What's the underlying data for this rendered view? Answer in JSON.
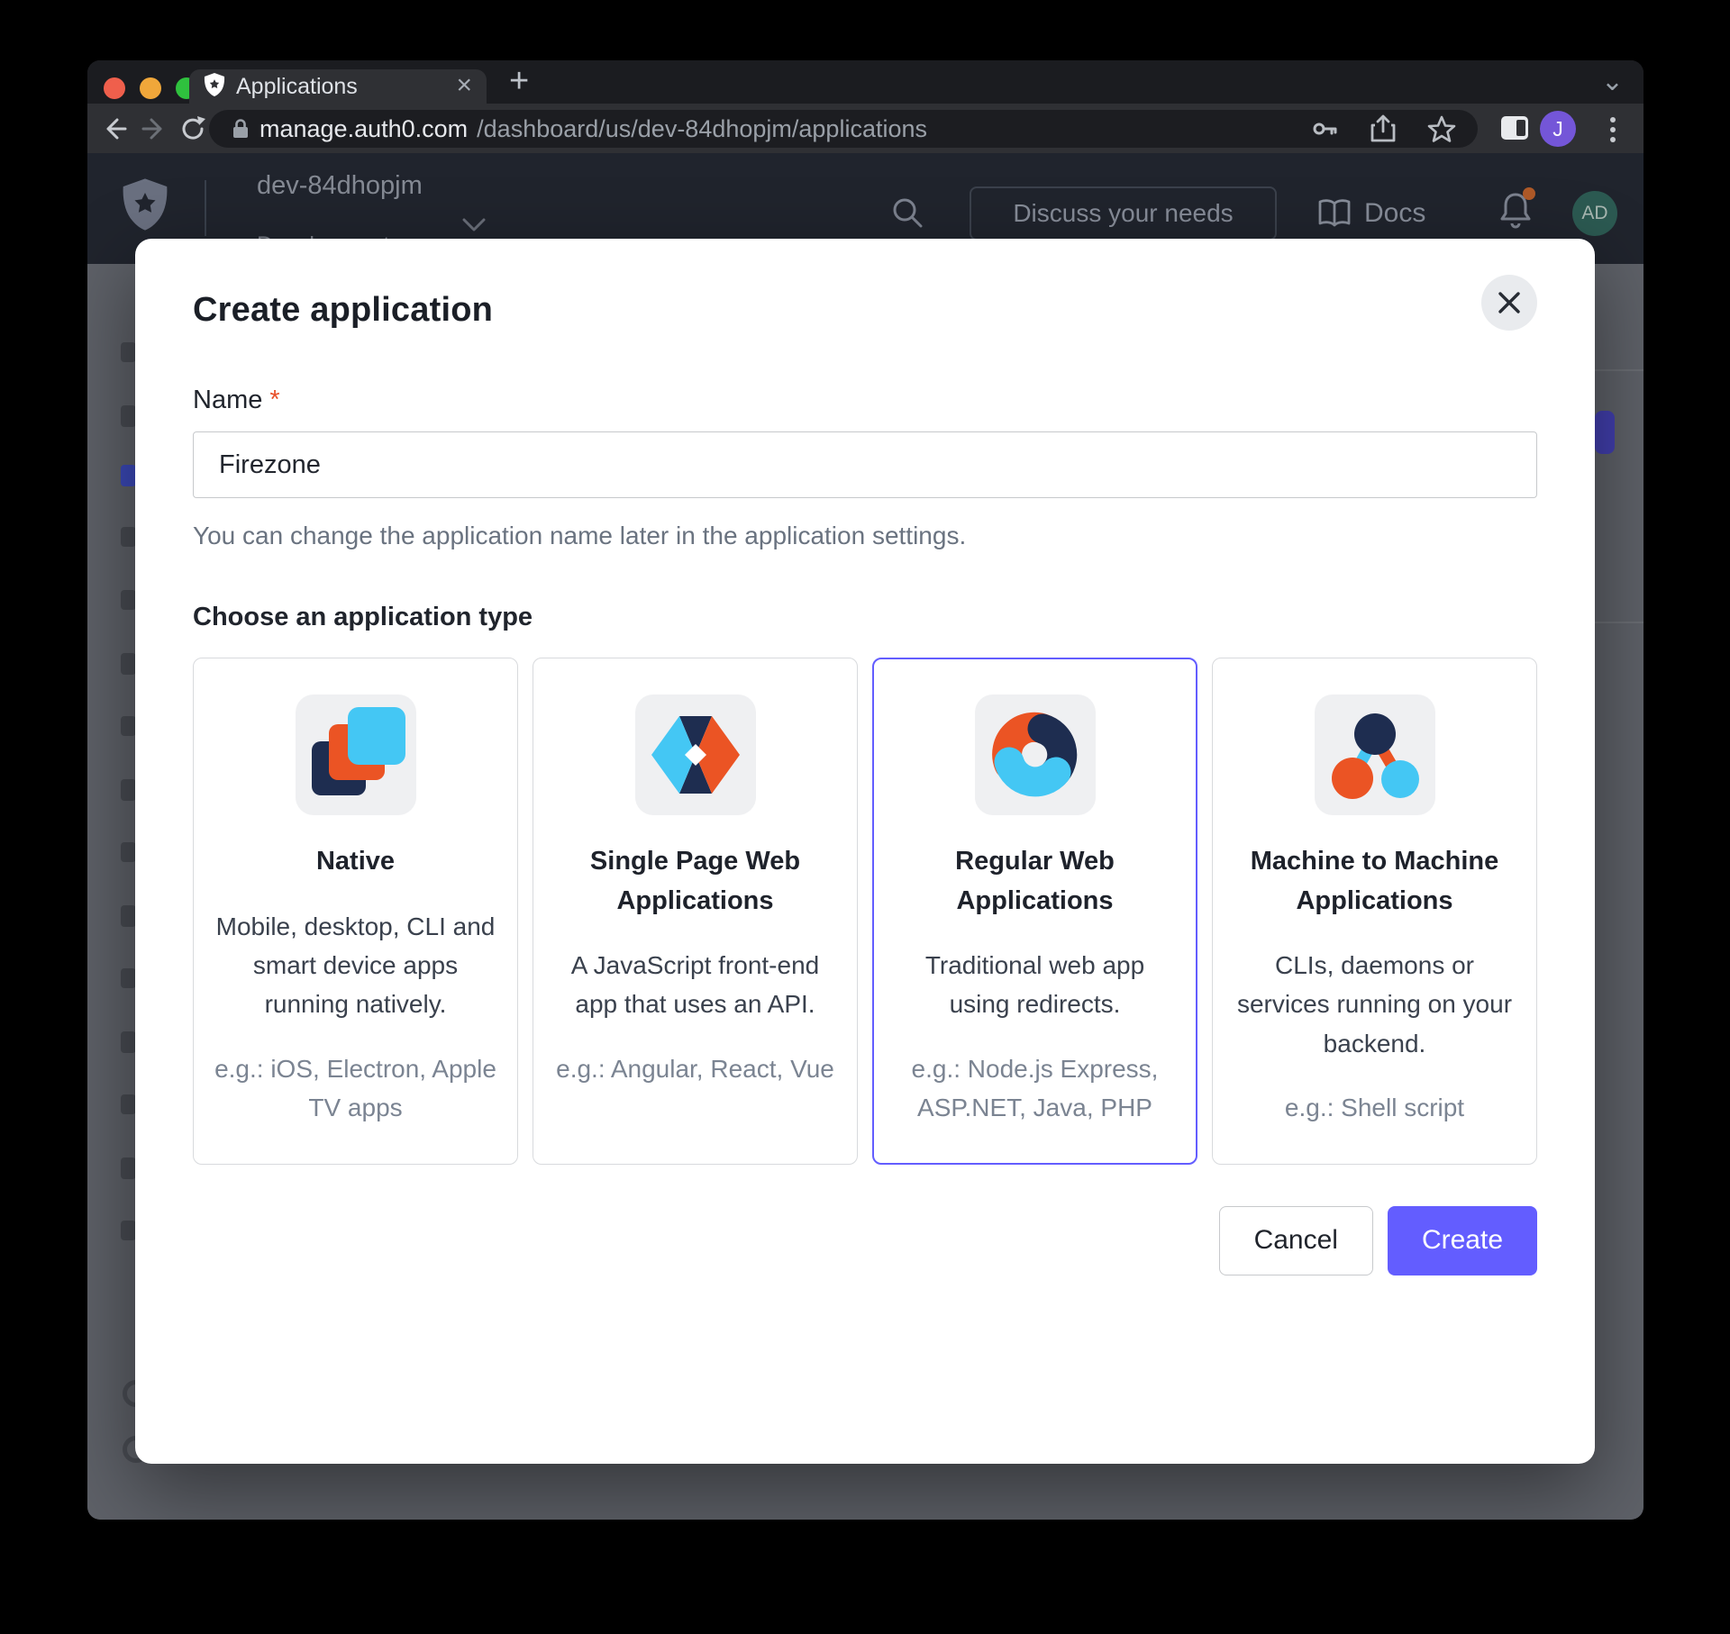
{
  "browser": {
    "tab_title": "Applications",
    "url_host": "manage.auth0.com",
    "url_path": "/dashboard/us/dev-84dhopjm/applications",
    "profile_initial": "J"
  },
  "icons": {
    "close": "×",
    "plus": "+",
    "chevron_down": "⌄"
  },
  "header": {
    "tenant": "dev-84dhopjm",
    "tenant_sub": "Development",
    "discuss_label": "Discuss your needs",
    "docs_label": "Docs",
    "avatar_initials": "AD"
  },
  "modal": {
    "title": "Create application",
    "name_label": "Name",
    "required_mark": "*",
    "name_value": "Firezone",
    "name_help": "You can change the application name later in the application settings.",
    "type_label": "Choose an application type",
    "cards": [
      {
        "title": "Native",
        "desc": "Mobile, desktop, CLI and smart device apps running natively.",
        "example": "e.g.: iOS, Electron, Apple TV apps"
      },
      {
        "title": "Single Page Web Applications",
        "desc": "A JavaScript front-end app that uses an API.",
        "example": "e.g.: Angular, React, Vue"
      },
      {
        "title": "Regular Web Applications",
        "desc": "Traditional web app using redirects.",
        "example": "e.g.: Node.js Express, ASP.NET, Java, PHP"
      },
      {
        "title": "Machine to Machine Applications",
        "desc": "CLIs, daemons or services running on your backend.",
        "example": "e.g.: Shell script"
      }
    ],
    "cancel_label": "Cancel",
    "create_label": "Create"
  },
  "colors": {
    "accent_indigo": "#635dff",
    "brand_orange": "#eb5424",
    "brand_blue": "#44c7f4",
    "brand_navy": "#1e2d50",
    "notification_dot": "#b05a28"
  }
}
